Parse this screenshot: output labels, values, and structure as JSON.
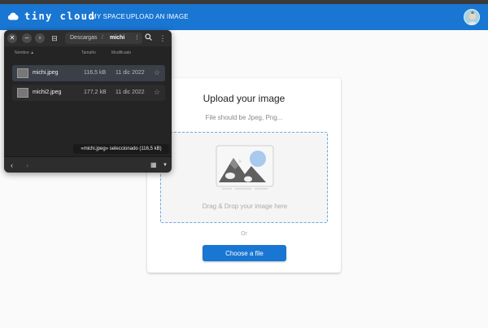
{
  "appbar": {
    "logo_text": "tiny cloud",
    "nav_my_space": "MY SPACE",
    "nav_upload": "UPLOAD AN IMAGE",
    "color": "#1976d2"
  },
  "upload": {
    "title": "Upload your image",
    "subtitle": "File should be Jpeg, Png...",
    "drop_text": "Drag & Drop your image here",
    "or_text": "Or",
    "choose_label": "Choose a file"
  },
  "file_chooser": {
    "path": [
      "Descargas",
      "michi"
    ],
    "path_separator": "/",
    "columns": {
      "name": "Nombre",
      "size": "Tamaño",
      "modified": "Modificado"
    },
    "files": [
      {
        "name": "michi.jpeg",
        "size": "116,5 kB",
        "modified": "11 dic 2022",
        "selected": true
      },
      {
        "name": "michi2.jpeg",
        "size": "177,2 kB",
        "modified": "11 dic 2022",
        "selected": false
      }
    ],
    "status": "«michi.jpeg» seleccionado (116,5 kB)",
    "icons": [
      "close-icon",
      "minimize-icon",
      "maximize-icon",
      "new-folder-icon",
      "search-icon",
      "menu-icon",
      "back-icon",
      "forward-icon",
      "grid-view-icon",
      "star-icon"
    ]
  }
}
